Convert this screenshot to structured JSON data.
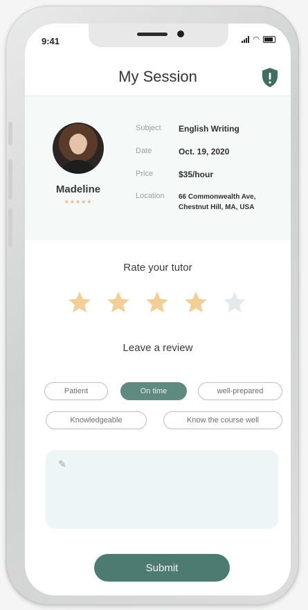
{
  "status": {
    "time": "9:41"
  },
  "header": {
    "title": "My Session"
  },
  "tutor": {
    "name": "Madeline",
    "rating_stars": "★★★★★"
  },
  "session": {
    "subject": {
      "label": "Subject",
      "value": "English Writing"
    },
    "date": {
      "label": "Date",
      "value": "Oct. 19, 2020"
    },
    "price": {
      "label": "Price",
      "value": "$35/hour"
    },
    "location": {
      "label": "Location",
      "line1": "66 Commonwealth Ave,",
      "line2": "Chestnut Hill, MA, USA"
    }
  },
  "rating": {
    "title": "Rate your tutor",
    "value": 4,
    "max": 5
  },
  "review": {
    "title": "Leave a review",
    "tags": [
      {
        "label": "Patient",
        "selected": false
      },
      {
        "label": "On time",
        "selected": true
      },
      {
        "label": "well-prepared",
        "selected": false
      },
      {
        "label": "Knowledgeable",
        "selected": false
      },
      {
        "label": "Know the course well",
        "selected": false
      }
    ],
    "input_placeholder": ""
  },
  "actions": {
    "submit_label": "Submit"
  },
  "colors": {
    "accent": "#5e8a80",
    "button": "#4d7a71",
    "star_filled": "#f2cf97",
    "star_empty": "#e5e9ec",
    "panel_bg": "#f5f9f8"
  }
}
